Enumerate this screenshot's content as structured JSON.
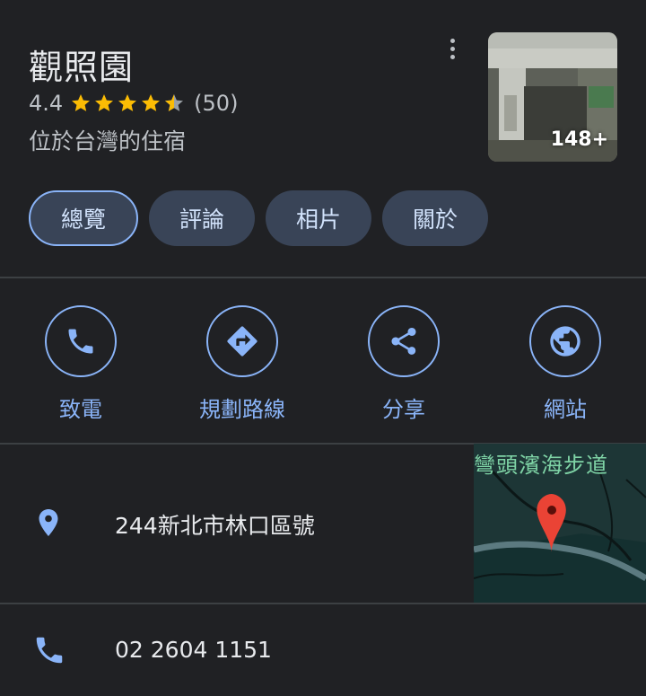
{
  "place": {
    "title": "觀照園",
    "rating": "4.4",
    "stars_value": 4.4,
    "review_count": "(50)",
    "subtitle": "位於台灣的住宿",
    "photo_count": "148+"
  },
  "tabs": [
    {
      "label": "總覽",
      "active": true
    },
    {
      "label": "評論",
      "active": false
    },
    {
      "label": "相片",
      "active": false
    },
    {
      "label": "關於",
      "active": false
    }
  ],
  "actions": [
    {
      "label": "致電",
      "icon": "phone-icon"
    },
    {
      "label": "規劃路線",
      "icon": "directions-icon"
    },
    {
      "label": "分享",
      "icon": "share-icon"
    },
    {
      "label": "網站",
      "icon": "globe-icon"
    }
  ],
  "address": {
    "text": "244新北市林口區號",
    "map_label": "彎頭濱海步道",
    "icon": "location-pin-icon"
  },
  "phone": {
    "text": "02 2604 1151",
    "icon": "phone-icon"
  },
  "colors": {
    "background": "#202124",
    "accent": "#8ab4f8",
    "star": "#fbbc04",
    "tab_bg": "#394457",
    "pin": "#ea4335"
  }
}
